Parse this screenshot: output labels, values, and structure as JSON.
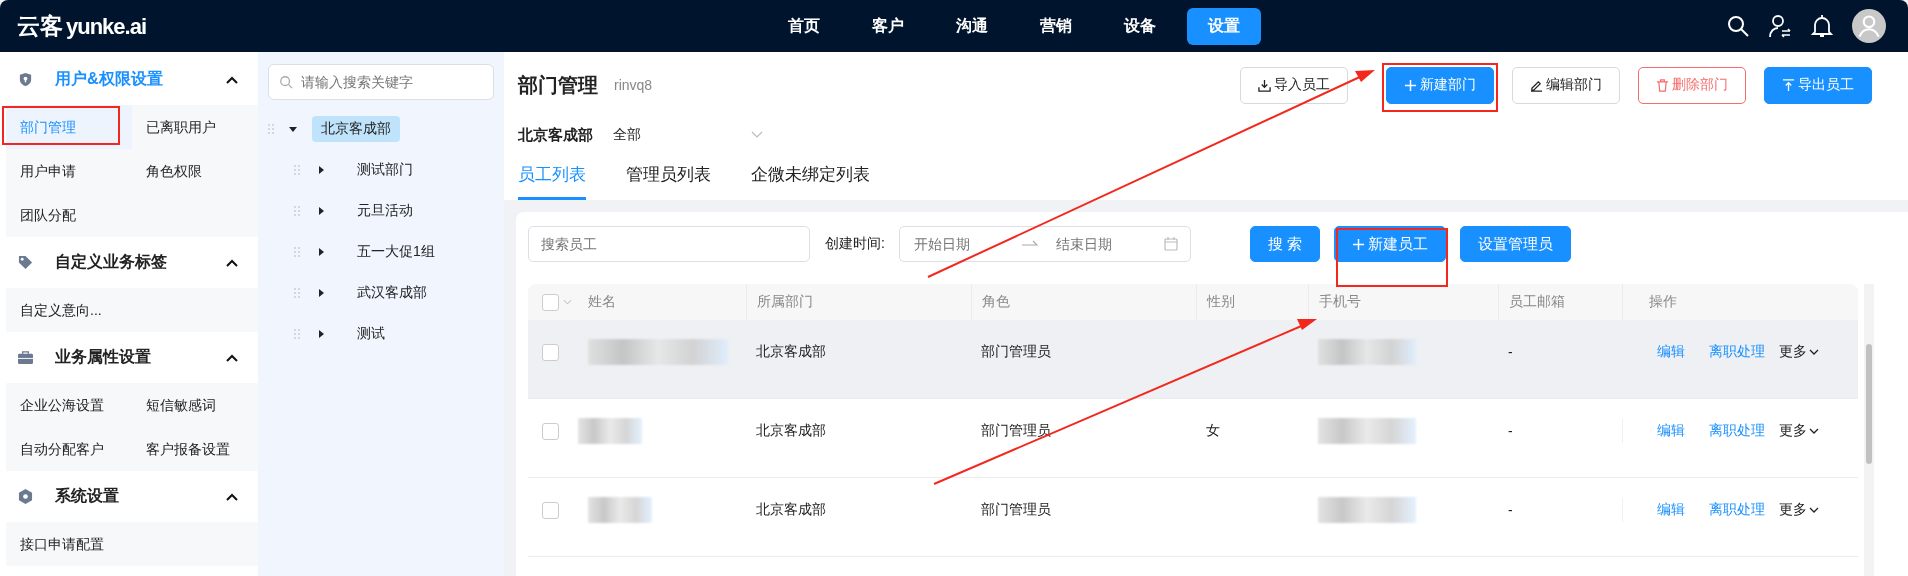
{
  "topbar": {
    "logo_cn": "云客",
    "logo_en": "yunke.ai",
    "nav": [
      {
        "label": "首页",
        "selected": false
      },
      {
        "label": "客户",
        "selected": false
      },
      {
        "label": "沟通",
        "selected": false
      },
      {
        "label": "营销",
        "selected": false
      },
      {
        "label": "设备",
        "selected": false
      },
      {
        "label": "设置",
        "selected": true
      }
    ]
  },
  "sidebar": {
    "groups": [
      {
        "title": "用户&权限设置",
        "kind": "shield",
        "selected": true,
        "expanded": true,
        "items": [
          {
            "label": "部门管理",
            "selected": true
          },
          {
            "label": "已离职用户",
            "selected": false
          },
          {
            "label": "用户申请",
            "selected": false
          },
          {
            "label": "角色权限",
            "selected": false
          },
          {
            "label": "团队分配",
            "selected": false
          }
        ]
      },
      {
        "title": "自定义业务标签",
        "kind": "tag",
        "selected": false,
        "expanded": true,
        "items": [
          {
            "label": "自定义意向...",
            "selected": false
          }
        ]
      },
      {
        "title": "业务属性设置",
        "kind": "briefcase",
        "selected": false,
        "expanded": true,
        "items": [
          {
            "label": "企业公海设置",
            "selected": false
          },
          {
            "label": "短信敏感词",
            "selected": false
          },
          {
            "label": "自动分配客户",
            "selected": false
          },
          {
            "label": "客户报备设置",
            "selected": false
          }
        ]
      },
      {
        "title": "系统设置",
        "kind": "hexagon",
        "selected": false,
        "expanded": true,
        "items": [
          {
            "label": "接口申请配置",
            "selected": false
          }
        ]
      }
    ]
  },
  "tree": {
    "placeholder": "请输入搜索关键字",
    "nodes": [
      {
        "label": "北京客成部",
        "selected": true,
        "expanded": true,
        "children": [
          {
            "label": "测试部门",
            "selected": false,
            "expanded": false
          },
          {
            "label": "元旦活动",
            "selected": false,
            "expanded": false
          },
          {
            "label": "五一大促1组",
            "selected": false,
            "expanded": false
          },
          {
            "label": "武汉客成部",
            "selected": false,
            "expanded": false
          },
          {
            "label": "测试",
            "selected": false,
            "expanded": false
          }
        ]
      }
    ]
  },
  "header": {
    "title": "部门管理",
    "subtitle": "rinvq8",
    "buttons": [
      {
        "label": "导入员工",
        "kind": "download"
      },
      {
        "label": "新建部门",
        "kind": "plus"
      },
      {
        "label": "编辑部门",
        "kind": "edit"
      },
      {
        "label": "删除部门",
        "kind": "delete"
      },
      {
        "label": "导出员工",
        "kind": "upload"
      }
    ]
  },
  "department_filter": {
    "label": "北京客成部",
    "value": "全部"
  },
  "tabs": [
    {
      "label": "员工列表",
      "selected": true
    },
    {
      "label": "管理员列表",
      "selected": false
    },
    {
      "label": "企微未绑定列表",
      "selected": false
    }
  ],
  "filters": {
    "search_placeholder": "搜索员工",
    "date_label": "创建时间:",
    "start_placeholder": "开始日期",
    "end_placeholder": "结束日期",
    "buttons": [
      {
        "label": "搜 索",
        "kind": "plain"
      },
      {
        "label": "新建员工",
        "kind": "plus"
      },
      {
        "label": "设置管理员",
        "kind": "plain"
      }
    ]
  },
  "table": {
    "columns": [
      "姓名",
      "所属部门",
      "角色",
      "性别",
      "手机号",
      "员工邮箱",
      "操作"
    ],
    "header_checked": false,
    "rows": [
      {
        "checked": false,
        "department": "北京客成部",
        "role": "部门管理员",
        "email": "-",
        "actions": [
          "编辑",
          "离职处理"
        ],
        "more": "更多",
        "hovered": true
      },
      {
        "checked": false,
        "department": "北京客成部",
        "role": "部门管理员",
        "gender": "女",
        "email": "-",
        "actions": [
          "编辑",
          "离职处理"
        ],
        "more": "更多",
        "hovered": false
      },
      {
        "checked": false,
        "department": "北京客成部",
        "role": "部门管理员",
        "email": "-",
        "actions": [
          "编辑",
          "离职处理"
        ],
        "more": "更多",
        "hovered": false
      }
    ]
  }
}
